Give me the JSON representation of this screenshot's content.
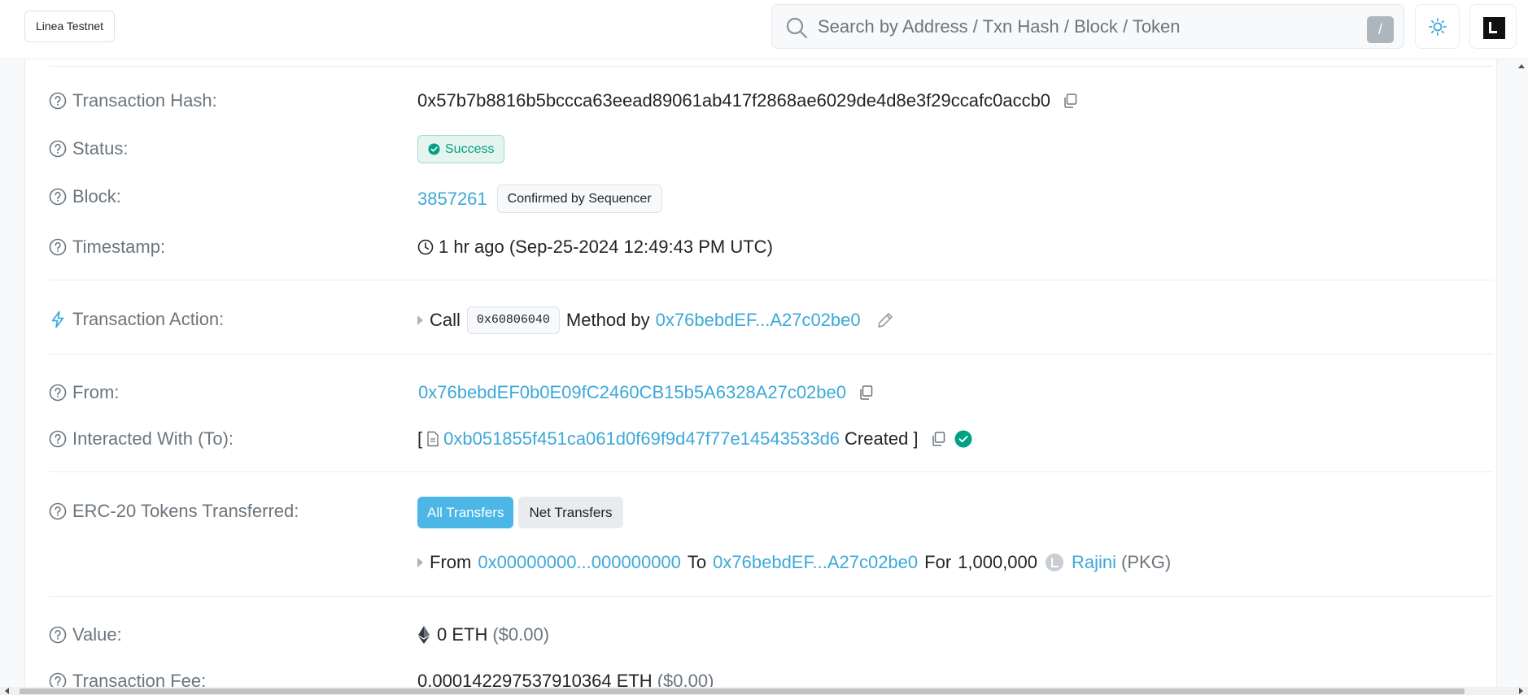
{
  "header": {
    "network_label": "Linea Testnet",
    "search_placeholder": "Search by Address / Txn Hash / Block / Token",
    "search_shortcut": "/"
  },
  "details": {
    "tx_hash": {
      "label": "Transaction Hash:",
      "value": "0x57b7b8816b5bccca63eead89061ab417f2868ae6029de4d8e3f29ccafc0accb0"
    },
    "status": {
      "label": "Status:",
      "value": "Success"
    },
    "block": {
      "label": "Block:",
      "number": "3857261",
      "confirmation": "Confirmed by Sequencer"
    },
    "timestamp": {
      "label": "Timestamp:",
      "value": "1 hr ago (Sep-25-2024 12:49:43 PM UTC)"
    },
    "action": {
      "label": "Transaction Action:",
      "call": "Call",
      "method_id": "0x60806040",
      "method_by": "Method by",
      "address": "0x76bebdEF...A27c02be0"
    },
    "from": {
      "label": "From:",
      "address": "0x76bebdEF0b0E09fC2460CB15b5A6328A27c02be0"
    },
    "to": {
      "label": "Interacted With (To):",
      "open_bracket": "[",
      "address": "0xb051855f451ca061d0f69f9d47f77e14543533d6",
      "created": "Created ]"
    },
    "erc20": {
      "label": "ERC-20 Tokens Transferred:",
      "tab_all": "All Transfers",
      "tab_net": "Net Transfers",
      "transfer": {
        "from_label": "From",
        "from_address": "0x00000000...000000000",
        "to_label": "To",
        "to_address": "0x76bebdEF...A27c02be0",
        "for_label": "For",
        "amount": "1,000,000",
        "token_name": "Rajini",
        "token_symbol": "(PKG)"
      }
    },
    "value": {
      "label": "Value:",
      "amount": "0 ETH",
      "usd": "($0.00)"
    },
    "fee": {
      "label": "Transaction Fee:",
      "amount": "0.000142297537910364 ETH",
      "usd": "($0.00)"
    }
  },
  "colors": {
    "accent": "#3ea8d8",
    "success": "#00a186",
    "primary_button": "#4cb6e6"
  }
}
